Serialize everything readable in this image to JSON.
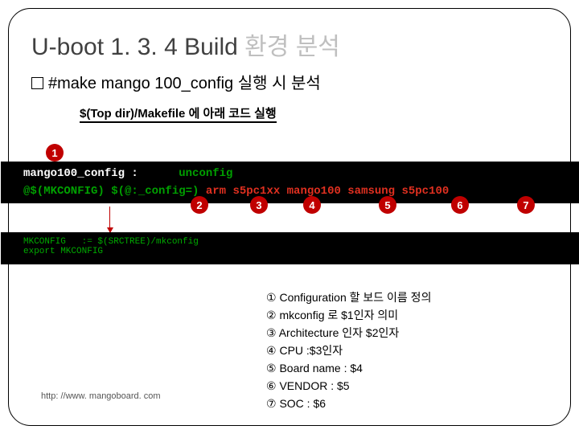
{
  "title_en": "U-boot 1. 3. 4 Build ",
  "title_ko": "환경 분석",
  "subtitle": "#make mango 100_config 실행 시 분석",
  "note": "$(Top dir)/Makefile 에 아래 코드 실행",
  "code1_line1a": "mango100_config :",
  "code1_line1b": "      unconfig",
  "code1_line2a": "@$(MKCONFIG) $(@:_config=)",
  "code1_line2b": " arm s5pc1xx mango100 samsung s5pc100",
  "code2": "MKCONFIG   := $(SRCTREE)/mkconfig\nexport MKCONFIG",
  "badges": {
    "b1": "1",
    "b2": "2",
    "b3": "3",
    "b4": "4",
    "b5": "5",
    "b6": "6",
    "b7": "7"
  },
  "legend": {
    "n1": "①",
    "t1": "Configuration 할 보드 이름 정의",
    "n2": "②",
    "t2": "mkconfig 로 $1인자 의미",
    "n3": "③",
    "t3": "Architecture 인자 $2인자",
    "n4": "④",
    "t4": "CPU  :$3인자",
    "n5": "⑤",
    "t5": "Board name : $4",
    "n6": "⑥",
    "t6": "VENDOR : $5",
    "n7": "⑦",
    "t7": "SOC : $6"
  },
  "footer": "http: //www. mangoboard. com"
}
